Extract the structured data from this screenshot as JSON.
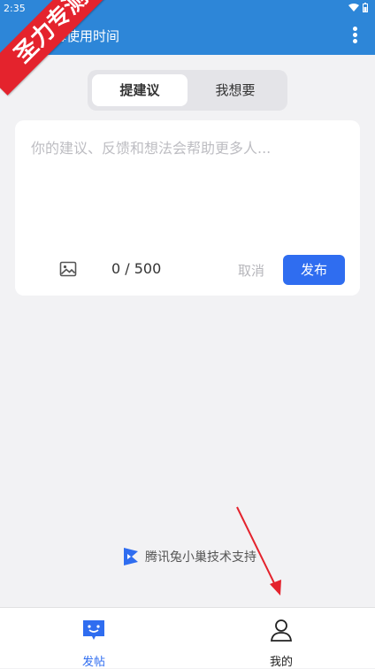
{
  "status_bar": {
    "time": "2:35"
  },
  "app_bar": {
    "title": "幕使用时间"
  },
  "ribbon": {
    "text": "圣力专测"
  },
  "tabs": [
    {
      "label": "提建议",
      "active": true
    },
    {
      "label": "我想要",
      "active": false
    }
  ],
  "composer": {
    "placeholder": "你的建议、反馈和想法会帮助更多人...",
    "value": "",
    "counter": "0 / 500",
    "cancel_label": "取消",
    "publish_label": "发布"
  },
  "support": {
    "text": "腾讯兔小巢技术支持"
  },
  "bottom_nav": [
    {
      "label": "发帖",
      "icon": "post-icon",
      "active": true
    },
    {
      "label": "我的",
      "icon": "person-icon",
      "active": false
    }
  ],
  "colors": {
    "primary": "#2d86d8",
    "accent_button": "#2f6df0",
    "ribbon": "#e4232d"
  }
}
